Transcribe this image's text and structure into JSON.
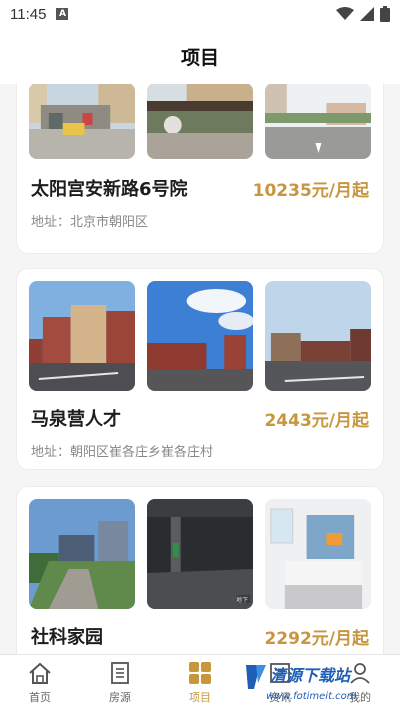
{
  "status": {
    "time": "11:45",
    "app_icon": "A"
  },
  "header": {
    "title": "项目"
  },
  "projects": [
    {
      "name": "太阳宫安新路6号院",
      "price": "10235元/月起",
      "address": "地址：北京市朝阳区"
    },
    {
      "name": "马泉营人才",
      "price": "2443元/月起",
      "address": "地址：朝阳区崔各庄乡崔各庄村"
    },
    {
      "name": "社科家园",
      "price": "2292元/月起",
      "address": ""
    }
  ],
  "photo_captions": {
    "parking_caption": "地下"
  },
  "tabs": [
    {
      "label": "首页",
      "icon": "home-icon"
    },
    {
      "label": "房源",
      "icon": "building-icon"
    },
    {
      "label": "项目",
      "icon": "grid-icon",
      "active": true
    },
    {
      "label": "资讯",
      "icon": "news-icon"
    },
    {
      "label": "我的",
      "icon": "user-icon"
    }
  ],
  "watermark": {
    "title": "清源下载站",
    "url": "www.fotimeit.com"
  },
  "colors": {
    "accent": "#c8963e",
    "background": "#f5f5f5"
  }
}
